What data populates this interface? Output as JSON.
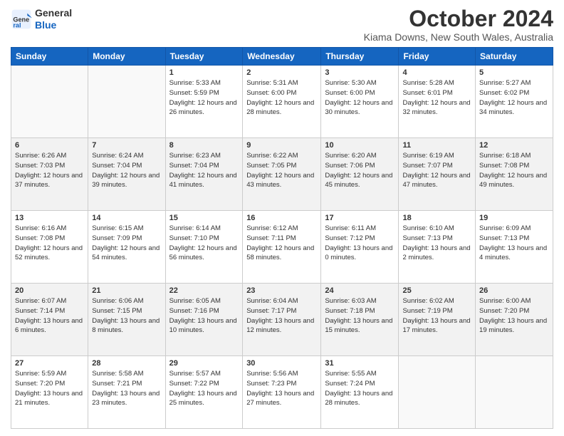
{
  "logo": {
    "line1": "General",
    "line2": "Blue"
  },
  "title": "October 2024",
  "subtitle": "Kiama Downs, New South Wales, Australia",
  "days_of_week": [
    "Sunday",
    "Monday",
    "Tuesday",
    "Wednesday",
    "Thursday",
    "Friday",
    "Saturday"
  ],
  "weeks": [
    [
      {
        "day": "",
        "info": ""
      },
      {
        "day": "",
        "info": ""
      },
      {
        "day": "1",
        "sunrise": "Sunrise: 5:33 AM",
        "sunset": "Sunset: 5:59 PM",
        "daylight": "Daylight: 12 hours and 26 minutes."
      },
      {
        "day": "2",
        "sunrise": "Sunrise: 5:31 AM",
        "sunset": "Sunset: 6:00 PM",
        "daylight": "Daylight: 12 hours and 28 minutes."
      },
      {
        "day": "3",
        "sunrise": "Sunrise: 5:30 AM",
        "sunset": "Sunset: 6:00 PM",
        "daylight": "Daylight: 12 hours and 30 minutes."
      },
      {
        "day": "4",
        "sunrise": "Sunrise: 5:28 AM",
        "sunset": "Sunset: 6:01 PM",
        "daylight": "Daylight: 12 hours and 32 minutes."
      },
      {
        "day": "5",
        "sunrise": "Sunrise: 5:27 AM",
        "sunset": "Sunset: 6:02 PM",
        "daylight": "Daylight: 12 hours and 34 minutes."
      }
    ],
    [
      {
        "day": "6",
        "sunrise": "Sunrise: 6:26 AM",
        "sunset": "Sunset: 7:03 PM",
        "daylight": "Daylight: 12 hours and 37 minutes."
      },
      {
        "day": "7",
        "sunrise": "Sunrise: 6:24 AM",
        "sunset": "Sunset: 7:04 PM",
        "daylight": "Daylight: 12 hours and 39 minutes."
      },
      {
        "day": "8",
        "sunrise": "Sunrise: 6:23 AM",
        "sunset": "Sunset: 7:04 PM",
        "daylight": "Daylight: 12 hours and 41 minutes."
      },
      {
        "day": "9",
        "sunrise": "Sunrise: 6:22 AM",
        "sunset": "Sunset: 7:05 PM",
        "daylight": "Daylight: 12 hours and 43 minutes."
      },
      {
        "day": "10",
        "sunrise": "Sunrise: 6:20 AM",
        "sunset": "Sunset: 7:06 PM",
        "daylight": "Daylight: 12 hours and 45 minutes."
      },
      {
        "day": "11",
        "sunrise": "Sunrise: 6:19 AM",
        "sunset": "Sunset: 7:07 PM",
        "daylight": "Daylight: 12 hours and 47 minutes."
      },
      {
        "day": "12",
        "sunrise": "Sunrise: 6:18 AM",
        "sunset": "Sunset: 7:08 PM",
        "daylight": "Daylight: 12 hours and 49 minutes."
      }
    ],
    [
      {
        "day": "13",
        "sunrise": "Sunrise: 6:16 AM",
        "sunset": "Sunset: 7:08 PM",
        "daylight": "Daylight: 12 hours and 52 minutes."
      },
      {
        "day": "14",
        "sunrise": "Sunrise: 6:15 AM",
        "sunset": "Sunset: 7:09 PM",
        "daylight": "Daylight: 12 hours and 54 minutes."
      },
      {
        "day": "15",
        "sunrise": "Sunrise: 6:14 AM",
        "sunset": "Sunset: 7:10 PM",
        "daylight": "Daylight: 12 hours and 56 minutes."
      },
      {
        "day": "16",
        "sunrise": "Sunrise: 6:12 AM",
        "sunset": "Sunset: 7:11 PM",
        "daylight": "Daylight: 12 hours and 58 minutes."
      },
      {
        "day": "17",
        "sunrise": "Sunrise: 6:11 AM",
        "sunset": "Sunset: 7:12 PM",
        "daylight": "Daylight: 13 hours and 0 minutes."
      },
      {
        "day": "18",
        "sunrise": "Sunrise: 6:10 AM",
        "sunset": "Sunset: 7:13 PM",
        "daylight": "Daylight: 13 hours and 2 minutes."
      },
      {
        "day": "19",
        "sunrise": "Sunrise: 6:09 AM",
        "sunset": "Sunset: 7:13 PM",
        "daylight": "Daylight: 13 hours and 4 minutes."
      }
    ],
    [
      {
        "day": "20",
        "sunrise": "Sunrise: 6:07 AM",
        "sunset": "Sunset: 7:14 PM",
        "daylight": "Daylight: 13 hours and 6 minutes."
      },
      {
        "day": "21",
        "sunrise": "Sunrise: 6:06 AM",
        "sunset": "Sunset: 7:15 PM",
        "daylight": "Daylight: 13 hours and 8 minutes."
      },
      {
        "day": "22",
        "sunrise": "Sunrise: 6:05 AM",
        "sunset": "Sunset: 7:16 PM",
        "daylight": "Daylight: 13 hours and 10 minutes."
      },
      {
        "day": "23",
        "sunrise": "Sunrise: 6:04 AM",
        "sunset": "Sunset: 7:17 PM",
        "daylight": "Daylight: 13 hours and 12 minutes."
      },
      {
        "day": "24",
        "sunrise": "Sunrise: 6:03 AM",
        "sunset": "Sunset: 7:18 PM",
        "daylight": "Daylight: 13 hours and 15 minutes."
      },
      {
        "day": "25",
        "sunrise": "Sunrise: 6:02 AM",
        "sunset": "Sunset: 7:19 PM",
        "daylight": "Daylight: 13 hours and 17 minutes."
      },
      {
        "day": "26",
        "sunrise": "Sunrise: 6:00 AM",
        "sunset": "Sunset: 7:20 PM",
        "daylight": "Daylight: 13 hours and 19 minutes."
      }
    ],
    [
      {
        "day": "27",
        "sunrise": "Sunrise: 5:59 AM",
        "sunset": "Sunset: 7:20 PM",
        "daylight": "Daylight: 13 hours and 21 minutes."
      },
      {
        "day": "28",
        "sunrise": "Sunrise: 5:58 AM",
        "sunset": "Sunset: 7:21 PM",
        "daylight": "Daylight: 13 hours and 23 minutes."
      },
      {
        "day": "29",
        "sunrise": "Sunrise: 5:57 AM",
        "sunset": "Sunset: 7:22 PM",
        "daylight": "Daylight: 13 hours and 25 minutes."
      },
      {
        "day": "30",
        "sunrise": "Sunrise: 5:56 AM",
        "sunset": "Sunset: 7:23 PM",
        "daylight": "Daylight: 13 hours and 27 minutes."
      },
      {
        "day": "31",
        "sunrise": "Sunrise: 5:55 AM",
        "sunset": "Sunset: 7:24 PM",
        "daylight": "Daylight: 13 hours and 28 minutes."
      },
      {
        "day": "",
        "info": ""
      },
      {
        "day": "",
        "info": ""
      }
    ]
  ]
}
